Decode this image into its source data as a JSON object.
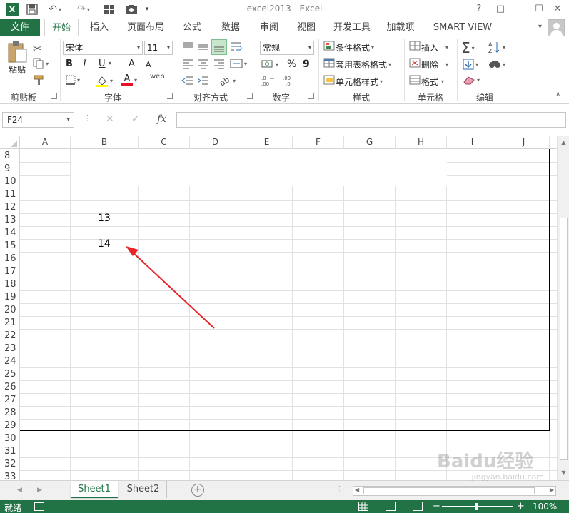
{
  "title_bar": {
    "title": "excel2013 - Excel",
    "help": "?",
    "restore": "□",
    "minimize": "—",
    "maximize": "☐",
    "close": "✕"
  },
  "tabs": {
    "file": "文件",
    "items": [
      "开始",
      "插入",
      "页面布局",
      "公式",
      "数据",
      "审阅",
      "视图",
      "开发工具",
      "加载项",
      "SMART VIEW"
    ]
  },
  "ribbon": {
    "clipboard": {
      "paste": "粘贴",
      "label": "剪贴板"
    },
    "font": {
      "name": "宋体",
      "size": "11",
      "bold": "B",
      "italic": "I",
      "underline": "U",
      "grow": "A",
      "shrink": "A",
      "font_color": "A",
      "wen": "wén",
      "label": "字体"
    },
    "alignment": {
      "label": "对齐方式"
    },
    "number": {
      "format": "常规",
      "percent": "%",
      "comma": "9",
      "label": "数字"
    },
    "styles": {
      "conditional": "条件格式",
      "table": "套用表格格式",
      "cell": "单元格样式",
      "label": "样式"
    },
    "cells": {
      "insert": "插入",
      "delete": "删除",
      "format": "格式",
      "label": "单元格"
    },
    "editing": {
      "label": "编辑"
    }
  },
  "formula_bar": {
    "name_box": "F24",
    "cancel": "✕",
    "enter": "✓",
    "fx": "fx",
    "value": ""
  },
  "grid": {
    "columns": [
      "A",
      "B",
      "C",
      "D",
      "E",
      "F",
      "G",
      "H",
      "I",
      "J"
    ],
    "rows": [
      "8",
      "9",
      "10",
      "11",
      "12",
      "13",
      "14",
      "15",
      "16",
      "17",
      "18",
      "19",
      "20",
      "21",
      "22",
      "23",
      "24",
      "25",
      "26",
      "27",
      "28",
      "29",
      "30",
      "31",
      "32",
      "33"
    ],
    "cells": {
      "b13": "13",
      "b15": "14"
    }
  },
  "sheets": {
    "tabs": [
      "Sheet1",
      "Sheet2"
    ],
    "active": "Sheet1",
    "add": "+"
  },
  "status_bar": {
    "status": "就绪",
    "zoom_minus": "−",
    "zoom_plus": "+",
    "zoom": "100%"
  },
  "watermark": {
    "text": "Baidu经验",
    "url": "jingyan.baidu.com"
  },
  "colors": {
    "accent": "#217346",
    "arrow": "#e8242a"
  }
}
